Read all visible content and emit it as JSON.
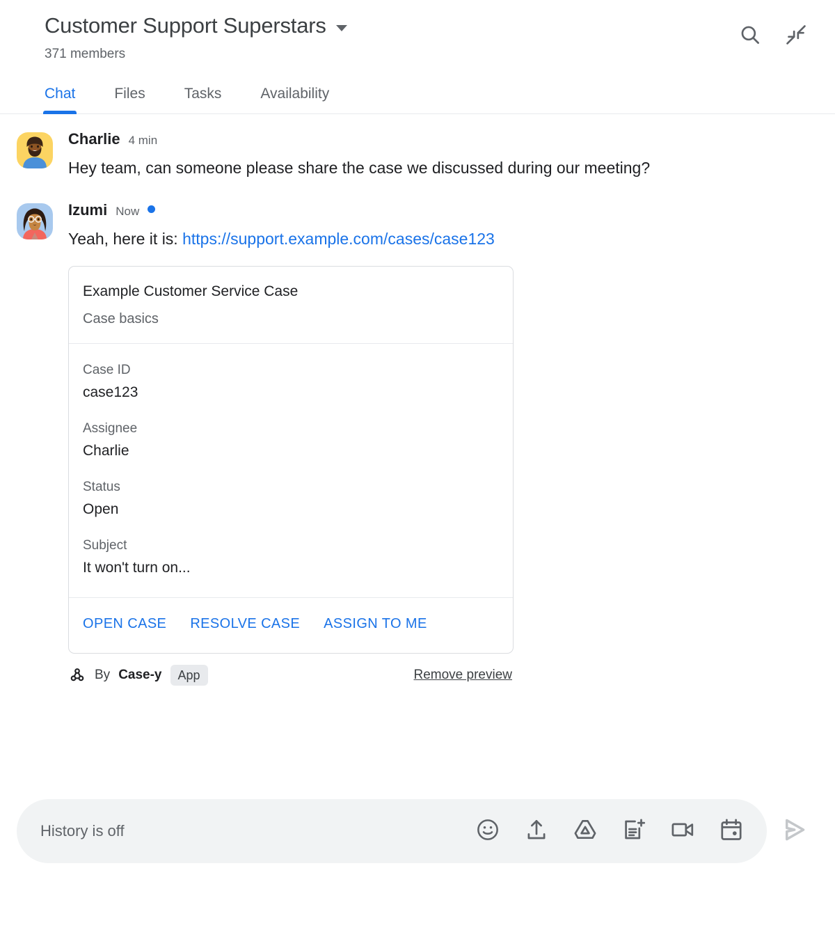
{
  "header": {
    "space_title": "Customer Support Superstars",
    "member_count": "371 members",
    "dropdown_icon": "chevron-down-icon",
    "search_icon": "search-icon",
    "collapse_icon": "collapse-arrows-icon"
  },
  "tabs": [
    {
      "label": "Chat",
      "active": true
    },
    {
      "label": "Files",
      "active": false
    },
    {
      "label": "Tasks",
      "active": false
    },
    {
      "label": "Availability",
      "active": false
    }
  ],
  "messages": [
    {
      "author": "Charlie",
      "time": "4 min",
      "unread": false,
      "text": "Hey team, can someone please share the case we discussed during our meeting?",
      "avatar": "charlie-avatar"
    },
    {
      "author": "Izumi",
      "time": "Now",
      "unread": true,
      "text_prefix": "Yeah, here it is: ",
      "link_text": "https://support.example.com/cases/case123",
      "avatar": "izumi-avatar"
    }
  ],
  "card": {
    "title": "Example Customer Service Case",
    "subtitle": "Case basics",
    "fields": [
      {
        "label": "Case ID",
        "value": "case123"
      },
      {
        "label": "Assignee",
        "value": "Charlie"
      },
      {
        "label": "Status",
        "value": "Open"
      },
      {
        "label": "Subject",
        "value": "It won't turn on..."
      }
    ],
    "actions": [
      "OPEN CASE",
      "RESOLVE CASE",
      "ASSIGN TO ME"
    ]
  },
  "card_footer": {
    "bot_icon": "webhook-icon",
    "by_label": "By",
    "app_name": "Case-y",
    "app_chip": "App",
    "remove_preview": "Remove preview"
  },
  "composer": {
    "placeholder": "History is off",
    "tools": [
      {
        "name": "emoji-icon",
        "title": "Insert emoji"
      },
      {
        "name": "upload-icon",
        "title": "Upload file"
      },
      {
        "name": "drive-icon",
        "title": "Add from Drive"
      },
      {
        "name": "new-doc-icon",
        "title": "Create new document"
      },
      {
        "name": "video-icon",
        "title": "Add video meeting"
      },
      {
        "name": "calendar-icon",
        "title": "Create event"
      }
    ],
    "send_icon": "send-icon"
  },
  "colors": {
    "accent": "#1a73e8",
    "text_primary": "#202124",
    "text_secondary": "#5f6368",
    "border": "#dadce0",
    "composer_bg": "#f1f3f4",
    "chip_bg": "#e8eaed"
  }
}
